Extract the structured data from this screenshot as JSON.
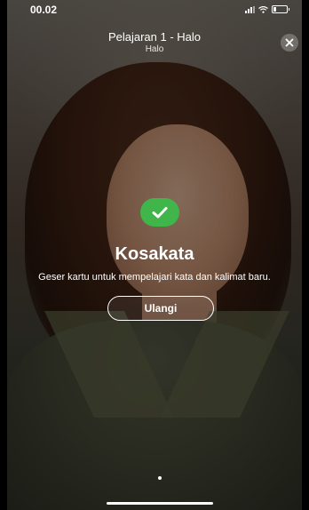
{
  "status_bar": {
    "time": "00.02",
    "icons": [
      "signal-icon",
      "wifi-icon",
      "battery-icon"
    ]
  },
  "header": {
    "title": "Pelajaran 1 - Halo",
    "subtitle": "Halo",
    "close_icon": "close-icon"
  },
  "card": {
    "status_icon": "checkmark-icon",
    "accent_color": "#3fb54a",
    "heading": "Kosakata",
    "description": "Geser kartu untuk mempelajari kata dan kalimat baru.",
    "repeat_label": "Ulangi"
  }
}
